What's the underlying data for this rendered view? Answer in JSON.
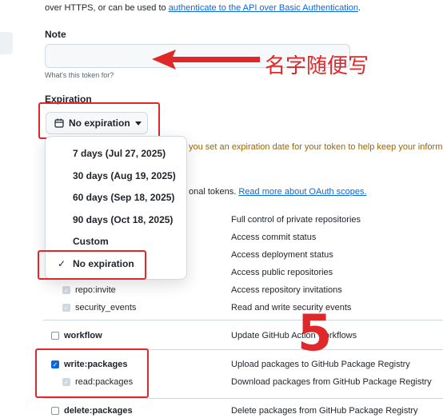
{
  "intro": {
    "text_before": "over HTTPS, or can be used to ",
    "link": "authenticate to the API over Basic Authentication",
    "text_after": "."
  },
  "note": {
    "label": "Note",
    "value": "",
    "help": "What's this token for?"
  },
  "annotation": {
    "note_text": "名字随便写",
    "number": "5",
    "color": "#e0282b"
  },
  "expiration": {
    "label": "Expiration",
    "selected": "No expiration",
    "warning_partial": "you set an expiration date for your token to help keep your information",
    "options": [
      "7 days (Jul 27, 2025)",
      "30 days (Aug 19, 2025)",
      "60 days (Sep 18, 2025)",
      "90 days (Oct 18, 2025)",
      "Custom",
      "No expiration"
    ],
    "checked_option": "No expiration"
  },
  "scopes_intro": {
    "text_partial": "onal tokens. ",
    "link": "Read more about OAuth scopes."
  },
  "scopes": {
    "repo_descriptions": [
      "Full control of private repositories",
      "Access commit status",
      "Access deployment status",
      "Access public repositories",
      "Access repository invitations",
      "Read and write security events"
    ],
    "repo_invite": "repo:invite",
    "security_events": "security_events",
    "workflow": {
      "name": "workflow",
      "desc": "Update GitHub Action workflows"
    },
    "write_packages": {
      "name": "write:packages",
      "desc": "Upload packages to GitHub Package Registry",
      "checked": true
    },
    "read_packages": {
      "name": "read:packages",
      "desc": "Download packages from GitHub Package Registry"
    },
    "delete_packages": {
      "name": "delete:packages",
      "desc": "Delete packages from GitHub Package Registry"
    }
  },
  "icons": {
    "calendar": "calendar-icon",
    "caret": "caret-down-icon",
    "check": "check-icon",
    "arrow": "arrow-left-annotation"
  }
}
